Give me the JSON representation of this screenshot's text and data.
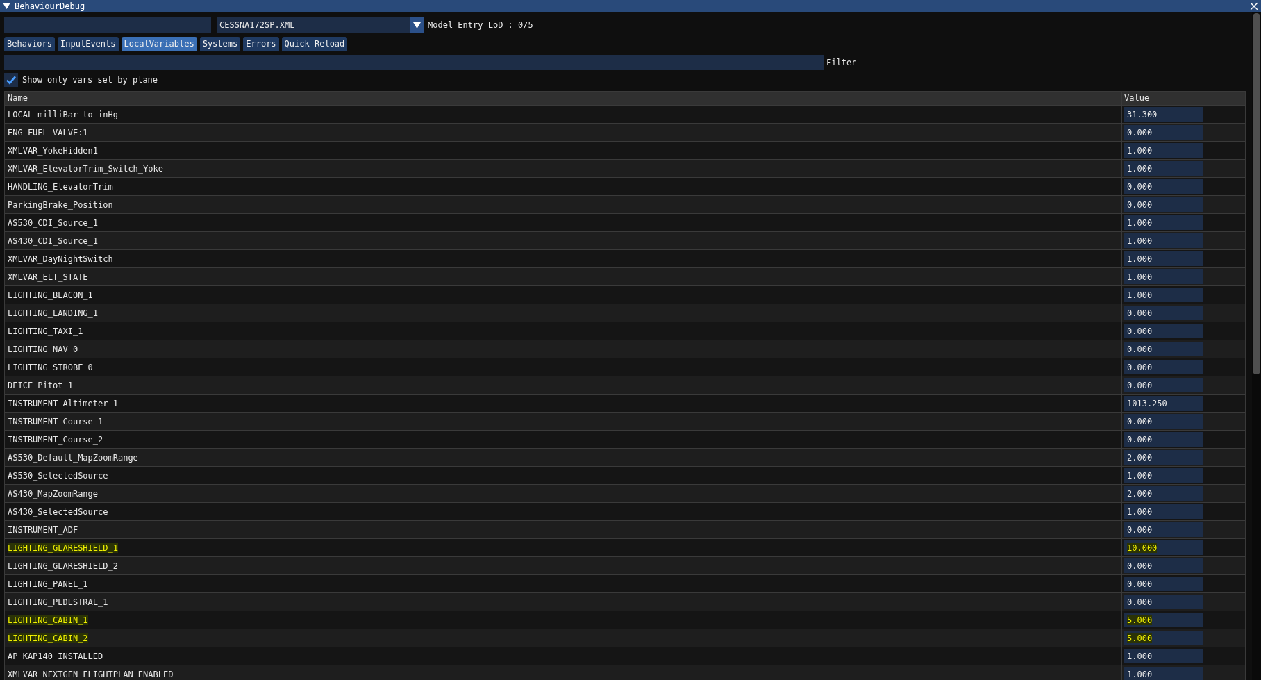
{
  "window": {
    "title": "BehaviourDebug"
  },
  "toolbar": {
    "model_select": {
      "value": "CESSNA172SP.XML"
    },
    "lod_label": "Model Entry LoD : 0/5"
  },
  "tabs": [
    {
      "label": "Behaviors",
      "selected": false
    },
    {
      "label": "InputEvents",
      "selected": false
    },
    {
      "label": "LocalVariables",
      "selected": true
    },
    {
      "label": "Systems",
      "selected": false
    },
    {
      "label": "Errors",
      "selected": false
    },
    {
      "label": "Quick Reload",
      "selected": false
    }
  ],
  "filter": {
    "label": "Filter"
  },
  "show_only_plane_vars": {
    "label": "Show only vars set by plane",
    "checked": true
  },
  "table": {
    "columns": [
      "Name",
      "Value"
    ],
    "rows": [
      {
        "name": "LOCAL_milliBar_to_inHg",
        "value": "31.300",
        "highlighted": false
      },
      {
        "name": "ENG FUEL VALVE:1",
        "value": "0.000",
        "highlighted": false
      },
      {
        "name": "XMLVAR_YokeHidden1",
        "value": "1.000",
        "highlighted": false
      },
      {
        "name": "XMLVAR_ElevatorTrim_Switch_Yoke",
        "value": "1.000",
        "highlighted": false
      },
      {
        "name": "HANDLING_ElevatorTrim",
        "value": "0.000",
        "highlighted": false
      },
      {
        "name": "ParkingBrake_Position",
        "value": "0.000",
        "highlighted": false
      },
      {
        "name": "AS530_CDI_Source_1",
        "value": "1.000",
        "highlighted": false
      },
      {
        "name": "AS430_CDI_Source_1",
        "value": "1.000",
        "highlighted": false
      },
      {
        "name": "XMLVAR_DayNightSwitch",
        "value": "1.000",
        "highlighted": false
      },
      {
        "name": "XMLVAR_ELT_STATE",
        "value": "1.000",
        "highlighted": false
      },
      {
        "name": "LIGHTING_BEACON_1",
        "value": "1.000",
        "highlighted": false
      },
      {
        "name": "LIGHTING_LANDING_1",
        "value": "0.000",
        "highlighted": false
      },
      {
        "name": "LIGHTING_TAXI_1",
        "value": "0.000",
        "highlighted": false
      },
      {
        "name": "LIGHTING_NAV_0",
        "value": "0.000",
        "highlighted": false
      },
      {
        "name": "LIGHTING_STROBE_0",
        "value": "0.000",
        "highlighted": false
      },
      {
        "name": "DEICE_Pitot_1",
        "value": "0.000",
        "highlighted": false
      },
      {
        "name": "INSTRUMENT_Altimeter_1",
        "value": "1013.250",
        "highlighted": false
      },
      {
        "name": "INSTRUMENT_Course_1",
        "value": "0.000",
        "highlighted": false
      },
      {
        "name": "INSTRUMENT_Course_2",
        "value": "0.000",
        "highlighted": false
      },
      {
        "name": "AS530_Default_MapZoomRange",
        "value": "2.000",
        "highlighted": false
      },
      {
        "name": "AS530_SelectedSource",
        "value": "1.000",
        "highlighted": false
      },
      {
        "name": "AS430_MapZoomRange",
        "value": "2.000",
        "highlighted": false
      },
      {
        "name": "AS430_SelectedSource",
        "value": "1.000",
        "highlighted": false
      },
      {
        "name": "INSTRUMENT_ADF",
        "value": "0.000",
        "highlighted": false
      },
      {
        "name": "LIGHTING_GLARESHIELD_1",
        "value": "10.000",
        "highlighted": true
      },
      {
        "name": "LIGHTING_GLARESHIELD_2",
        "value": "0.000",
        "highlighted": false
      },
      {
        "name": "LIGHTING_PANEL_1",
        "value": "0.000",
        "highlighted": false
      },
      {
        "name": "LIGHTING_PEDESTRAL_1",
        "value": "0.000",
        "highlighted": false
      },
      {
        "name": "LIGHTING_CABIN_1",
        "value": "5.000",
        "highlighted": true
      },
      {
        "name": "LIGHTING_CABIN_2",
        "value": "5.000",
        "highlighted": true
      },
      {
        "name": "AP_KAP140_INSTALLED",
        "value": "1.000",
        "highlighted": false
      },
      {
        "name": "XMLVAR_NEXTGEN_FLIGHTPLAN_ENABLED",
        "value": "1.000",
        "highlighted": false
      }
    ]
  }
}
